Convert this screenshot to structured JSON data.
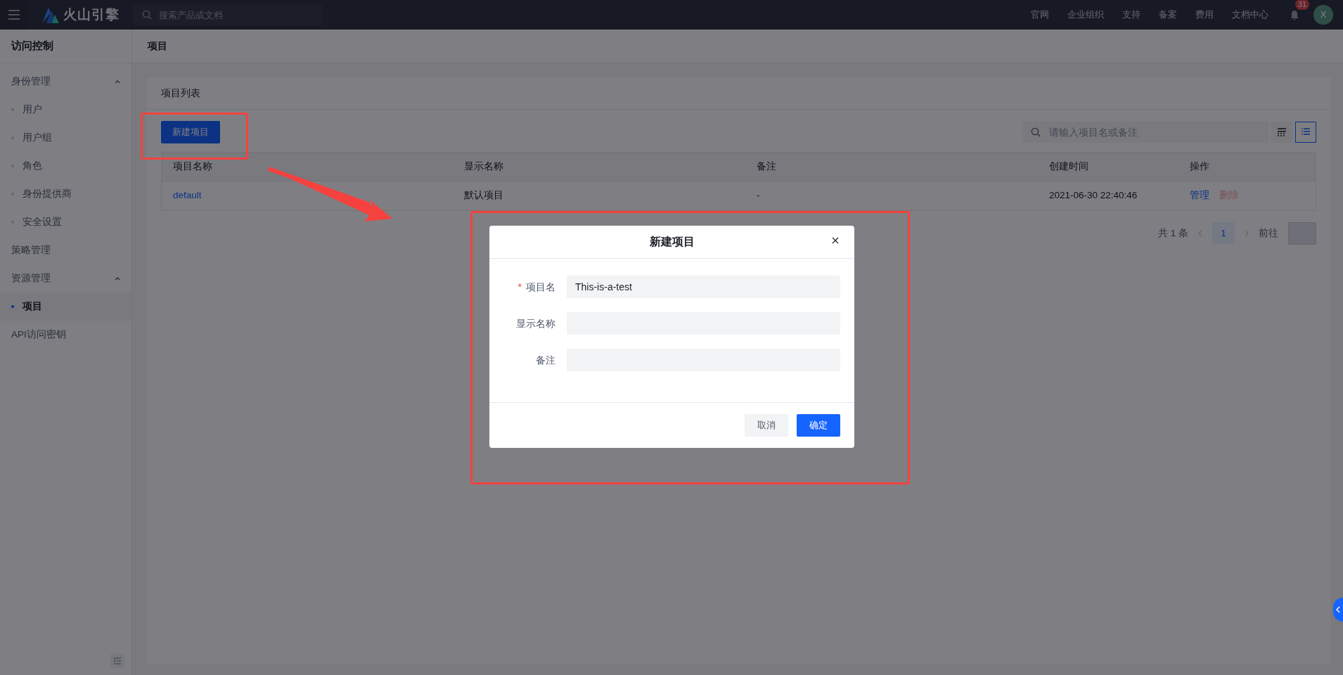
{
  "topbar": {
    "logo_text": "火山引擎",
    "search": {
      "placeholder": "搜索产品或文档"
    },
    "links": [
      "官网",
      "企业组织",
      "支持",
      "备案",
      "费用",
      "文档中心"
    ],
    "notification_count": "31",
    "avatar_initial": "X"
  },
  "sidebar": {
    "title": "访问控制",
    "items": [
      {
        "kind": "group",
        "label": "身份管理",
        "expanded": true,
        "children": [
          {
            "label": "用户",
            "selected": false
          },
          {
            "label": "用户组",
            "selected": false
          },
          {
            "label": "角色",
            "selected": false
          },
          {
            "label": "身份提供商",
            "selected": false
          },
          {
            "label": "安全设置",
            "selected": false
          }
        ]
      },
      {
        "kind": "link",
        "label": "策略管理",
        "selected": false
      },
      {
        "kind": "group",
        "label": "资源管理",
        "expanded": true,
        "children": [
          {
            "label": "项目",
            "selected": true
          }
        ]
      },
      {
        "kind": "link",
        "label": "API访问密钥",
        "selected": false
      }
    ]
  },
  "page_title": "项目",
  "card": {
    "title": "项目列表",
    "new_button": "新建项目",
    "search": {
      "placeholder": "请输入项目名或备注"
    },
    "view_modes": [
      {
        "kind": "table-settings",
        "selected": false
      },
      {
        "kind": "list",
        "selected": true
      }
    ],
    "table": {
      "columns": [
        "项目名称",
        "显示名称",
        "备注",
        "创建时间",
        "操作"
      ],
      "rows": [
        {
          "name": "default",
          "display_name": "默认项目",
          "note": "-",
          "created": "2021-06-30 22:40:46",
          "actions": [
            {
              "label": "管理",
              "kind": "primary"
            },
            {
              "label": "删除",
              "kind": "danger"
            }
          ]
        }
      ]
    },
    "pagination": {
      "total": "共 1 条",
      "pages": [
        {
          "label": "1",
          "selected": true
        }
      ],
      "goto_label": "前往"
    }
  },
  "modal": {
    "title": "新建项目",
    "required_mark": "*",
    "fields": [
      {
        "label": "项目名",
        "required": true,
        "value": "This-is-a-test"
      },
      {
        "label": "显示名称",
        "required": false
      },
      {
        "label": "备注",
        "required": false
      }
    ],
    "buttons": [
      {
        "label": "取消",
        "kind": "secondary"
      },
      {
        "label": "确定",
        "kind": "primary"
      }
    ]
  }
}
